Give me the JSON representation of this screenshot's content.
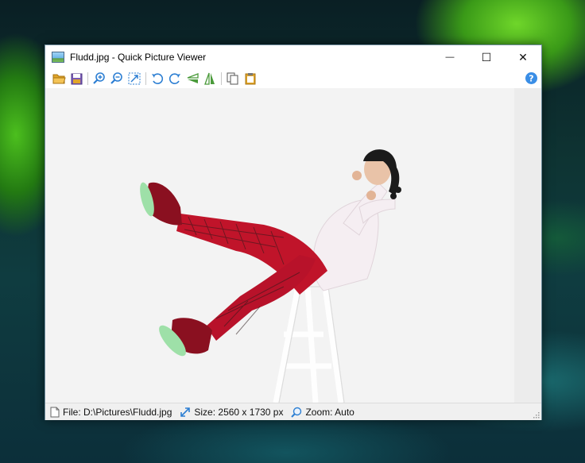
{
  "window": {
    "title": "Fludd.jpg - Quick Picture Viewer"
  },
  "controls": {
    "minimize": "—",
    "maximize": "☐",
    "close": "✕"
  },
  "toolbar": {
    "buttons": [
      "open-folder-icon",
      "save-icon",
      "zoom-in-icon",
      "zoom-out-icon",
      "fit-to-window-icon",
      "rotate-left-icon",
      "rotate-right-icon",
      "flip-horizontal-icon",
      "flip-vertical-icon",
      "copy-icon",
      "paste-icon"
    ],
    "help_icon": "help-icon"
  },
  "status": {
    "file": "File: D:\\Pictures\\Fludd.jpg",
    "size": "Size: 2560 x 1730 px",
    "zoom": "Zoom: Auto"
  },
  "colors": {
    "accent": "#2d7fd3",
    "pants_red": "#c0142a",
    "folder": "#e0a52a"
  }
}
